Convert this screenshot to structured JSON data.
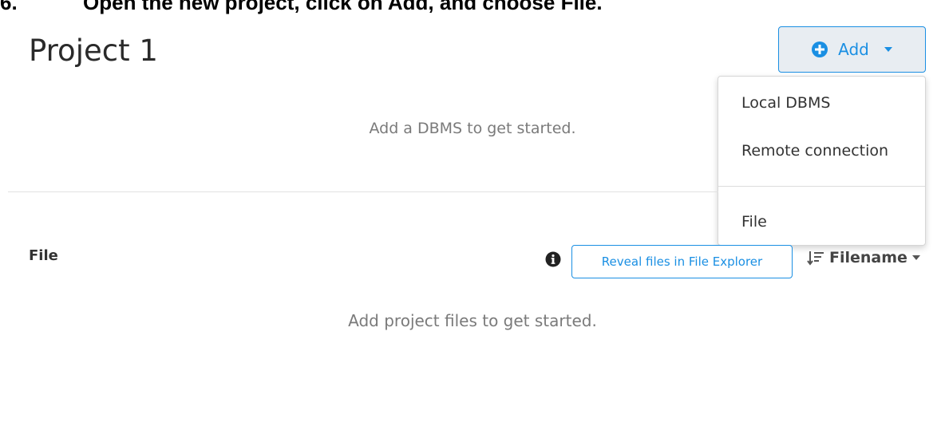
{
  "instruction": {
    "number": "6.",
    "text": "Open the new project, click on Add, and choose File."
  },
  "project": {
    "title": "Project 1"
  },
  "add_button": {
    "label": "Add",
    "icon": "plus-circle-icon",
    "caret": "chevron-down-icon"
  },
  "dropdown": {
    "items": [
      {
        "label": "Local DBMS"
      },
      {
        "label": "Remote connection"
      },
      {
        "label": "File"
      }
    ]
  },
  "dbms_section": {
    "empty_message": "Add a DBMS to get started."
  },
  "file_section": {
    "heading": "File",
    "reveal_button_label": "Reveal files in File Explorer",
    "sort_label": "Filename",
    "info_icon": "info-icon",
    "sort_icon": "sort-icon",
    "empty_message": "Add project files to get started."
  },
  "colors": {
    "accent": "#1a8fe3",
    "button_bg": "#e8edf2",
    "muted_text": "#7a7a7a"
  }
}
